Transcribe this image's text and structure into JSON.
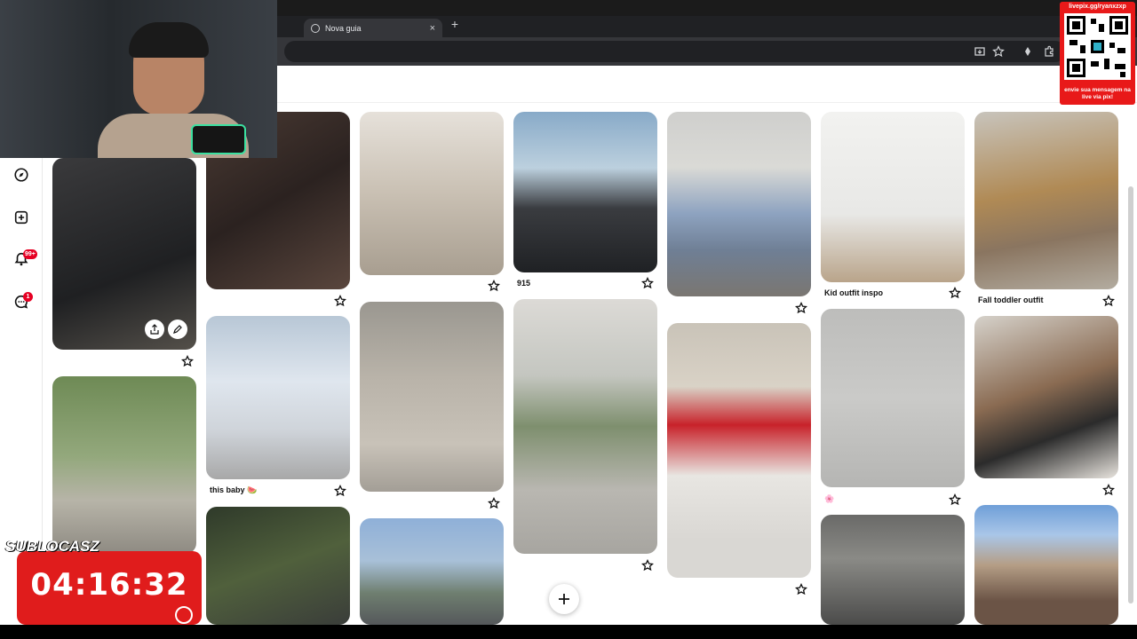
{
  "browser": {
    "tab_title": "Nova guia",
    "tab_close": "×",
    "new_tab": "+"
  },
  "pins": {
    "p915_title": "915",
    "kid_outfit_title": "Kid outfit inspo",
    "fall_toddler_title": "Fall toddler outfit",
    "this_baby_title": "this baby 🍉",
    "pink_title": "🌸"
  },
  "overlay": {
    "qr_url": "livepix.gg/ryanxzxp",
    "qr_message": "envie sua mensagem na live via pix!",
    "timer": "04:16:32",
    "timer_label": "SUBLOCASZ"
  },
  "rail": {
    "notifications_badge": "99+",
    "messages_badge": "1"
  },
  "colors": {
    "accent": "#e60023",
    "overlay_red": "#e01c1c"
  }
}
